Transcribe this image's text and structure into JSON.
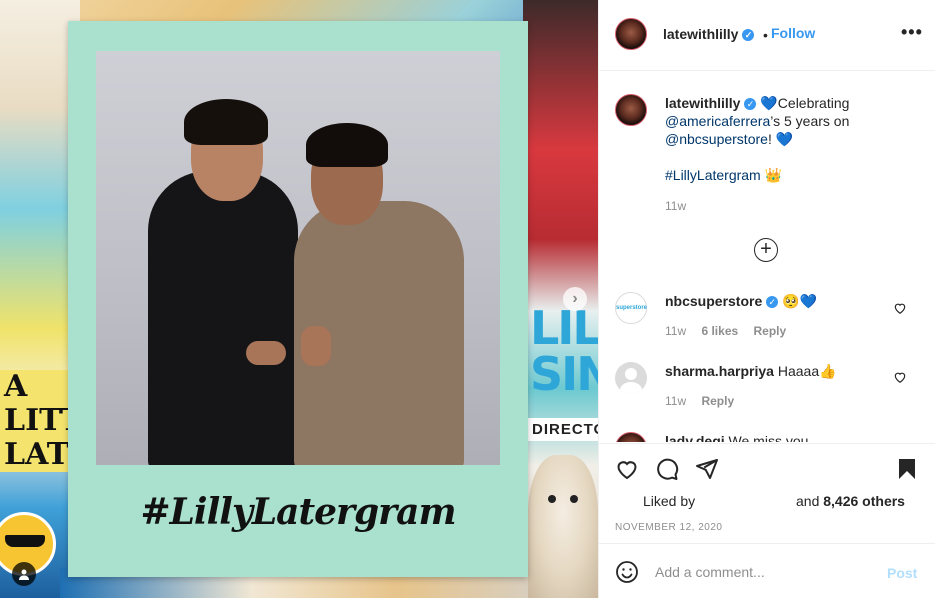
{
  "post": {
    "image_hashtag": "#LillyLatergram",
    "collage_left_text": "A LITT LAT",
    "collage_right_text": "LIL SIN",
    "collage_right_sub": "DIRECTO"
  },
  "header": {
    "username": "latewithlilly",
    "verified_glyph": "✓",
    "separator": "•",
    "follow_label": "Follow",
    "more_label": "•••"
  },
  "caption": {
    "username": "latewithlilly",
    "text_before": "💙Celebrating",
    "mention1": "@americaferrera",
    "text_middle": "’s 5 years on",
    "mention2": "@nbcsuperstore",
    "text_after": "! 💙",
    "hashtag": "#LillyLatergram",
    "hashtag_emoji": "👑",
    "time": "11w"
  },
  "load_more": "+",
  "comments": [
    {
      "username": "nbcsuperstore",
      "avatar_text": "superstore",
      "text": "🥺💙",
      "time": "11w",
      "likes": "6 likes",
      "reply": "Reply"
    },
    {
      "username": "sharma.harpriya",
      "text": "Haaaa👍",
      "time": "11w",
      "reply": "Reply"
    },
    {
      "username": "lady.degi",
      "text": "We miss you"
    }
  ],
  "actions": {
    "liked_by": "Liked by",
    "and_others": "and",
    "others_count": "8,426 others",
    "date": "NOVEMBER 12, 2020"
  },
  "add_comment": {
    "placeholder": "Add a comment...",
    "post_label": "Post"
  },
  "colors": {
    "accent": "#3897f0",
    "post_disabled": "#b2dffc",
    "polaroid": "#a9e0ce"
  }
}
